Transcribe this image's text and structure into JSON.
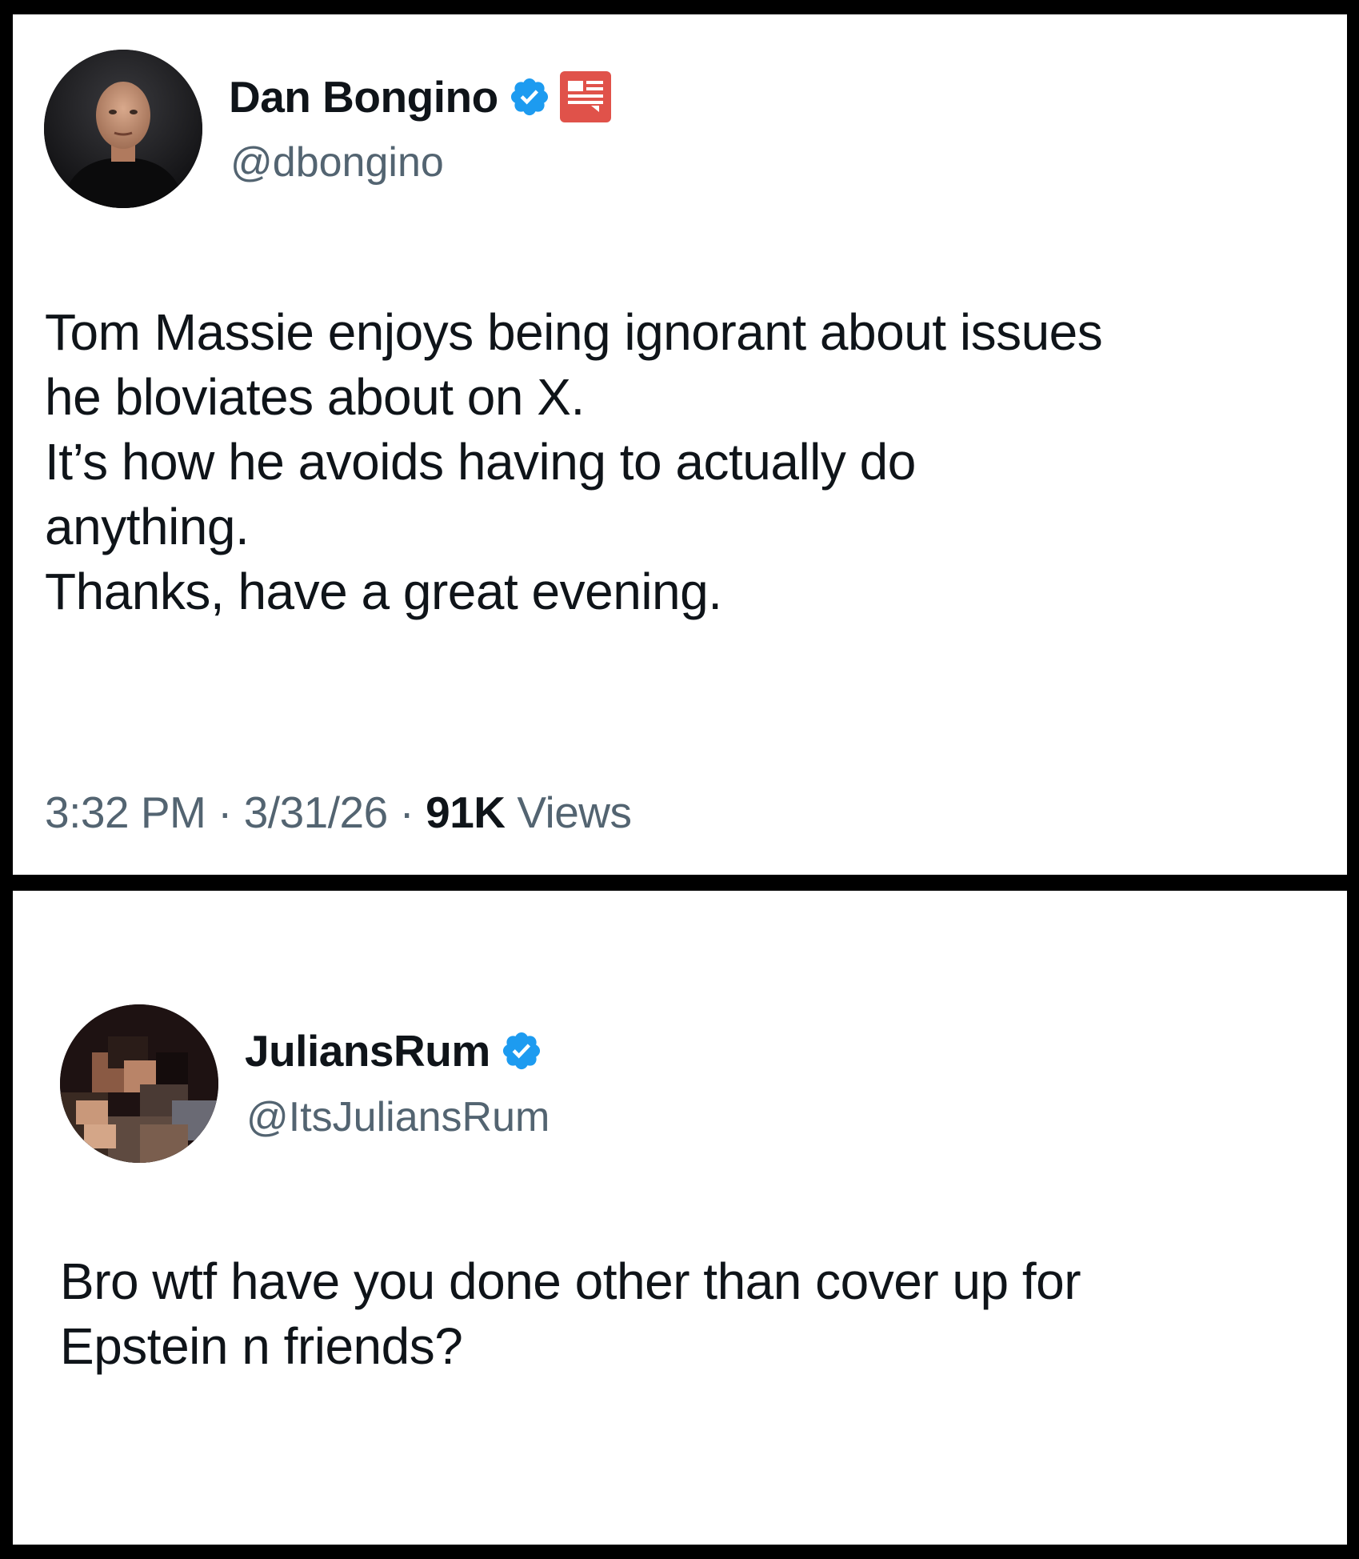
{
  "tweet": {
    "display_name": "Dan Bongino",
    "handle": "@dbongino",
    "verified_icon": "verified-badge-icon",
    "affiliation_icon": "government-affiliation-icon",
    "colors": {
      "verified": "#1d9bf0",
      "affiliation": "#e0524a"
    },
    "text_lines": [
      "Tom Massie enjoys being ignorant about issues",
      "he bloviates about on X.",
      "It’s how he avoids having to actually do",
      "anything.",
      "Thanks, have a great evening."
    ],
    "time": "3:32 PM",
    "separator": "·",
    "date": "3/31/26",
    "views_count": "91K",
    "views_label": "Views"
  },
  "reply": {
    "display_name": "JuliansRum",
    "handle": "@ItsJuliansRum",
    "verified_icon": "verified-badge-icon",
    "text_lines": [
      "Bro wtf have you done other than cover up for",
      "Epstein n friends?"
    ]
  }
}
